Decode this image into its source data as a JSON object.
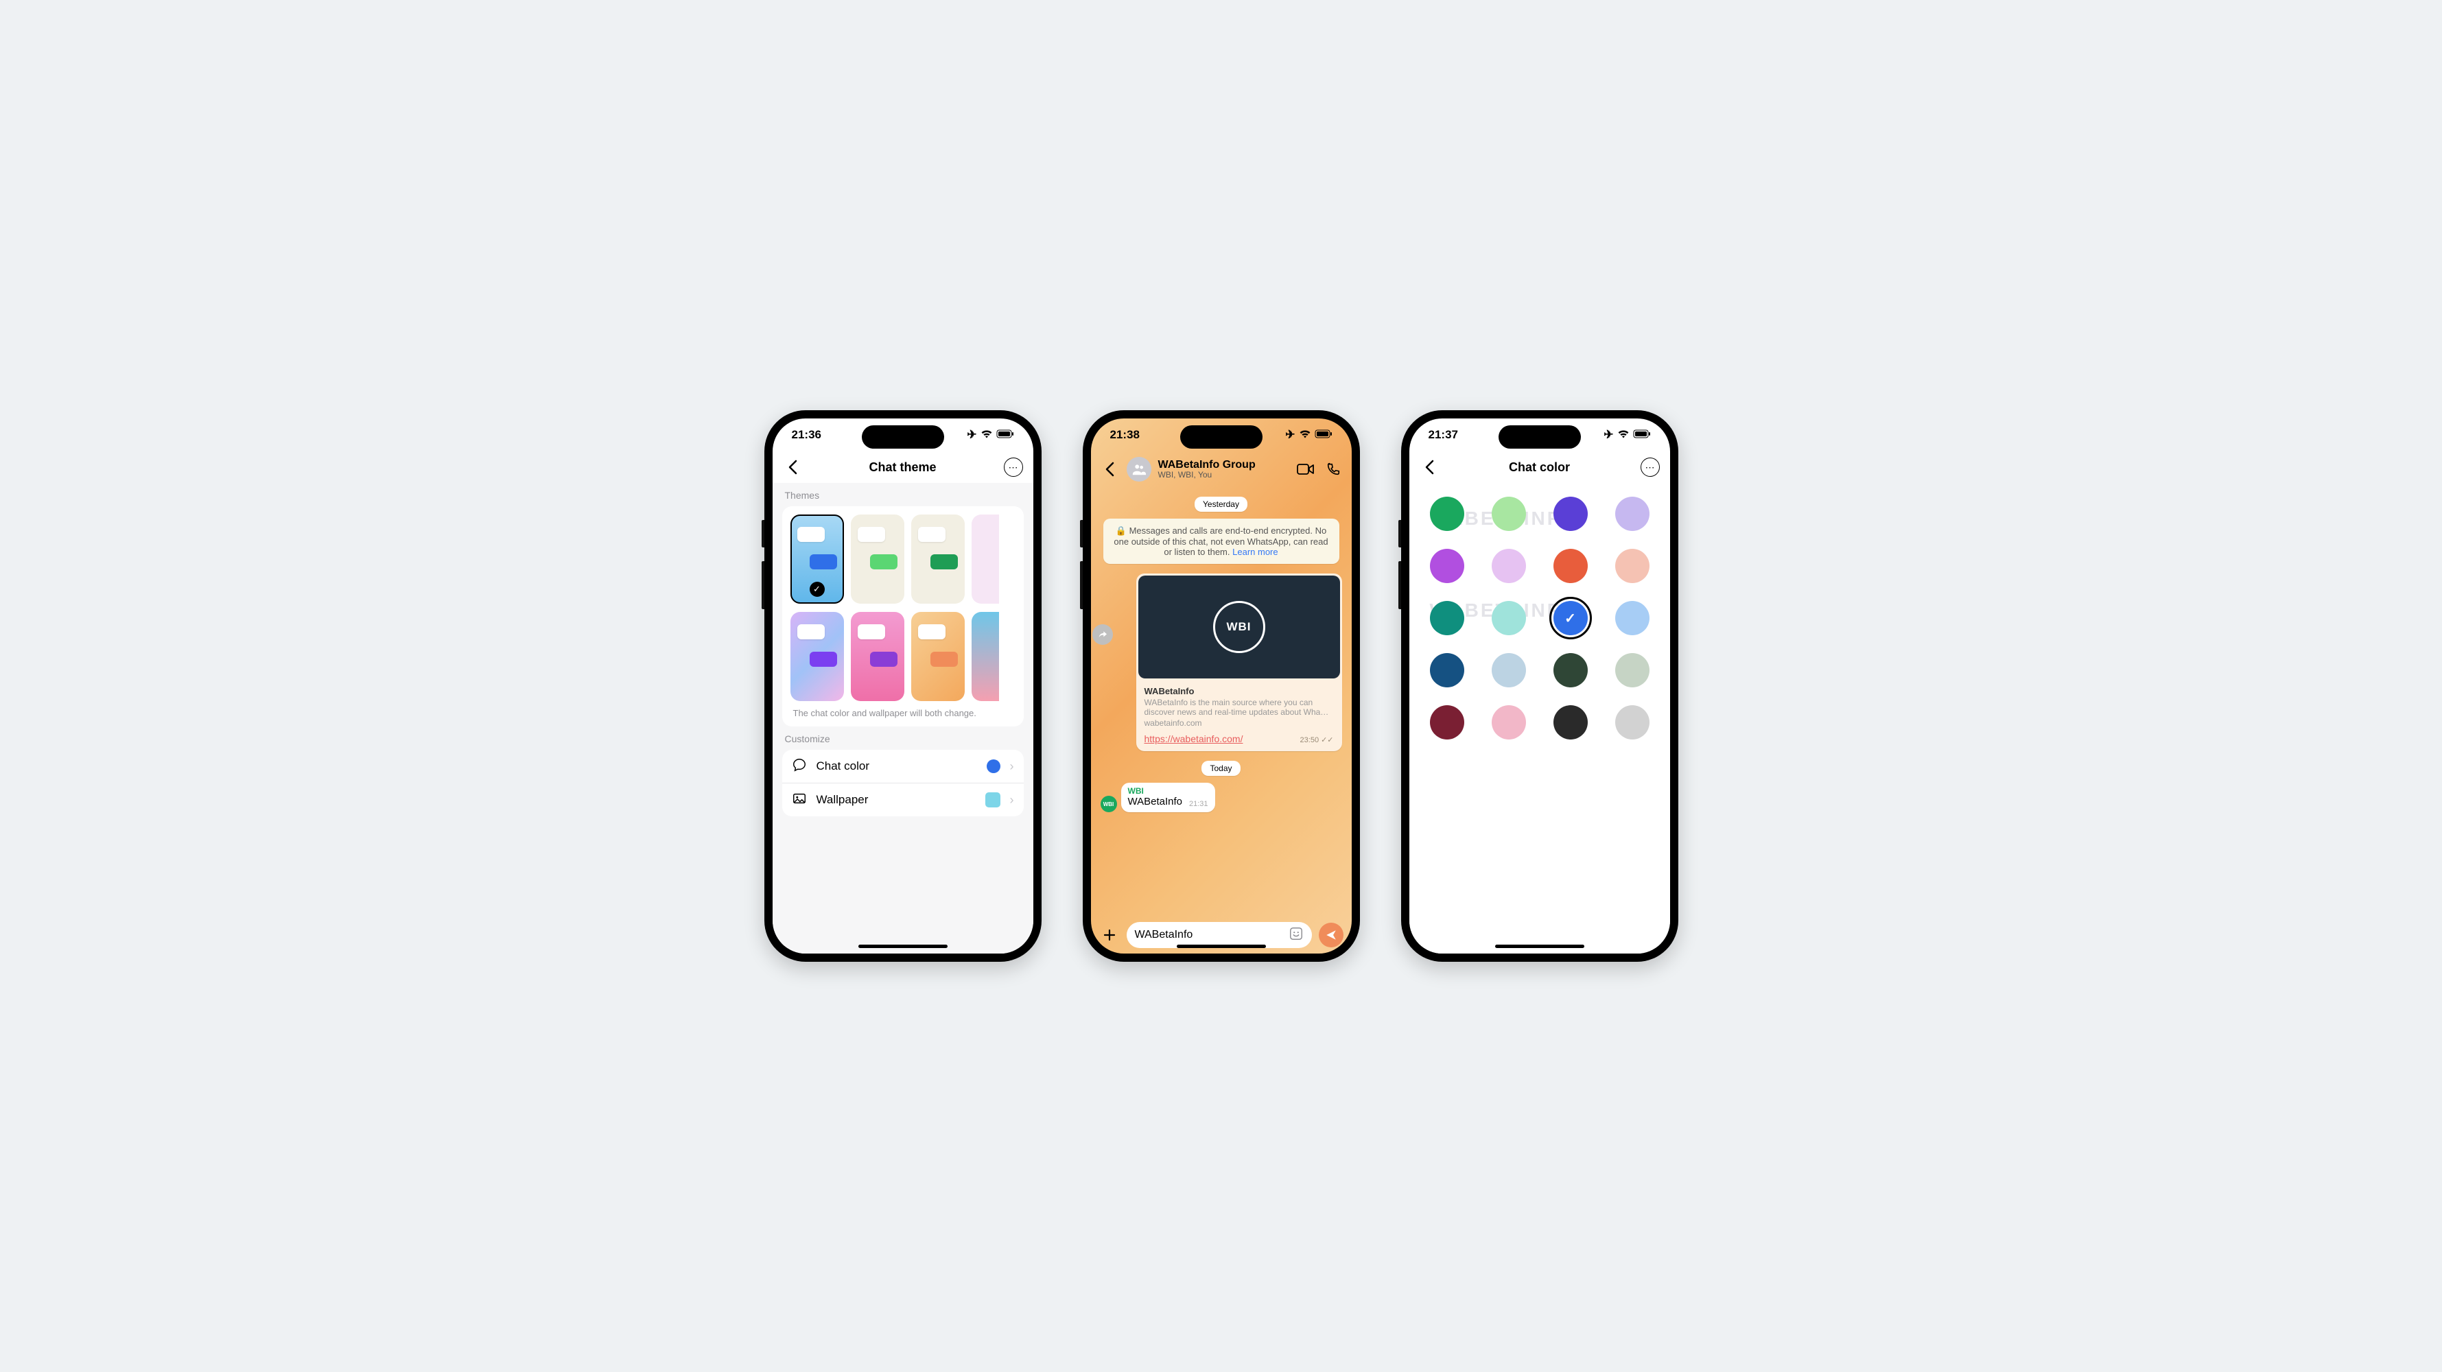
{
  "watermark_text": "WABETAINFO",
  "screen1": {
    "time": "21:36",
    "title": "Chat theme",
    "section_themes": "Themes",
    "footnote": "The chat color and wallpaper will both change.",
    "section_customize": "Customize",
    "row_chat_color": "Chat color",
    "row_wallpaper": "Wallpaper",
    "chat_color_value": "#2f6fe8",
    "wallpaper_thumb": "#7dd5e8",
    "themes": [
      {
        "bg": "linear-gradient(180deg,#a9d9f5,#5fb6ea)",
        "out": "#2f6fe8",
        "selected": true
      },
      {
        "bg": "#f2efe3",
        "out": "#5bd673",
        "selected": false
      },
      {
        "bg": "#f2efe3",
        "out": "#1f9d55",
        "selected": false
      },
      {
        "bg": "#f6e6f5",
        "out": "#7b3ff0",
        "selected": false,
        "cut": true
      },
      {
        "bg": "linear-gradient(135deg,#d7b4f7,#a1c2f7,#f2b7e8)",
        "out": "#7b3ff0",
        "selected": false
      },
      {
        "bg": "linear-gradient(180deg,#f39bd1,#ef6fa8)",
        "out": "#8a3dd6",
        "selected": false
      },
      {
        "bg": "linear-gradient(135deg,#f7cf95,#f3a85c)",
        "out": "#f08c5a",
        "selected": false
      },
      {
        "bg": "linear-gradient(180deg,#6fc6e8,#f59fb0)",
        "out": "#1f9d8f",
        "selected": false,
        "cut": true
      }
    ]
  },
  "screen2": {
    "time": "21:38",
    "group_name": "WABetaInfo Group",
    "group_sub": "WBI, WBI, You",
    "date1": "Yesterday",
    "encryption_notice": "Messages and calls are end-to-end encrypted. No one outside of this chat, not even WhatsApp, can read or listen to them.",
    "encryption_learn": "Learn more",
    "link_title": "WABetaInfo",
    "link_desc": "WABetaInfo is the main source where you can discover news and real-time updates about Wha…",
    "link_domain": "wabetainfo.com",
    "link_url": "https://wabetainfo.com/",
    "link_time": "23:50",
    "date2": "Today",
    "in_sender": "WBI",
    "in_text": "WABetaInfo",
    "in_time": "21:31",
    "compose_value": "WABetaInfo",
    "wbi_logo": "WBI"
  },
  "screen3": {
    "time": "21:37",
    "title": "Chat color",
    "colors": [
      {
        "hex": "#1aa85e"
      },
      {
        "hex": "#a8e6a1"
      },
      {
        "hex": "#5a3fd6"
      },
      {
        "hex": "#c6b8f0"
      },
      {
        "hex": "#b14fe0"
      },
      {
        "hex": "#e6c2f2"
      },
      {
        "hex": "#e85d3c"
      },
      {
        "hex": "#f5c2b3"
      },
      {
        "hex": "#0f8f7e"
      },
      {
        "hex": "#9fe3db"
      },
      {
        "hex": "#2f6fe8",
        "selected": true
      },
      {
        "hex": "#a7cdf5"
      },
      {
        "hex": "#155182"
      },
      {
        "hex": "#bcd3e3"
      },
      {
        "hex": "#2f4636"
      },
      {
        "hex": "#c6d4c5"
      },
      {
        "hex": "#7a1f33"
      },
      {
        "hex": "#f2b7c8"
      },
      {
        "hex": "#2a2a2a"
      },
      {
        "hex": "#d2d2d2"
      }
    ]
  }
}
